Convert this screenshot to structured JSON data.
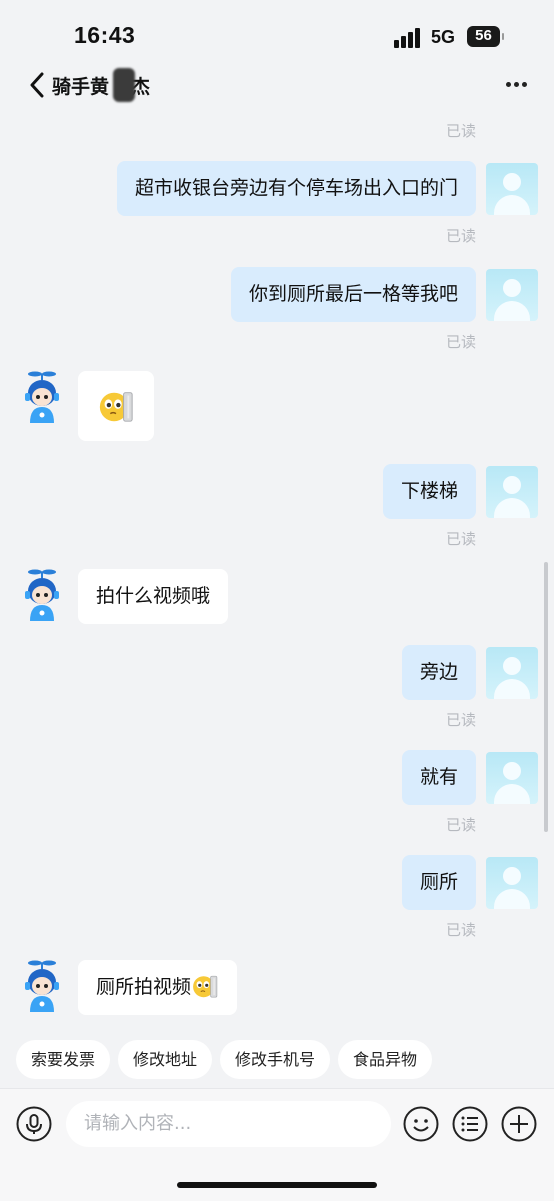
{
  "status_bar": {
    "time": "16:43",
    "network": "5G",
    "battery": "56"
  },
  "header": {
    "title_part1": "骑手黄",
    "title_part2": "杰"
  },
  "messages": [
    {
      "side": "me",
      "text": "超市收银台旁边有个停车场出入口的门",
      "read": "已读"
    },
    {
      "side": "me",
      "text": "你到厕所最后一格等我吧",
      "read": "已读"
    },
    {
      "side": "other",
      "text": "",
      "emoji": "peeking-face-emoji"
    },
    {
      "side": "me",
      "text": "下楼梯",
      "read": "已读"
    },
    {
      "side": "other",
      "text": "拍什么视频哦"
    },
    {
      "side": "me",
      "text": "旁边",
      "read": "已读"
    },
    {
      "side": "me",
      "text": "就有",
      "read": "已读"
    },
    {
      "side": "me",
      "text": "厕所",
      "read": "已读"
    },
    {
      "side": "other",
      "text": "厕所拍视频",
      "emoji": "peeking-face-emoji"
    }
  ],
  "top_read_label": "已读",
  "quick_replies": [
    "索要发票",
    "修改地址",
    "修改手机号",
    "食品异物"
  ],
  "input": {
    "placeholder": "请输入内容..."
  },
  "icons": {
    "back": "chevron-left-icon",
    "more": "more-dots-icon",
    "voice": "microphone-icon",
    "emoji": "smiley-icon",
    "menu": "list-icon",
    "add": "plus-icon"
  }
}
